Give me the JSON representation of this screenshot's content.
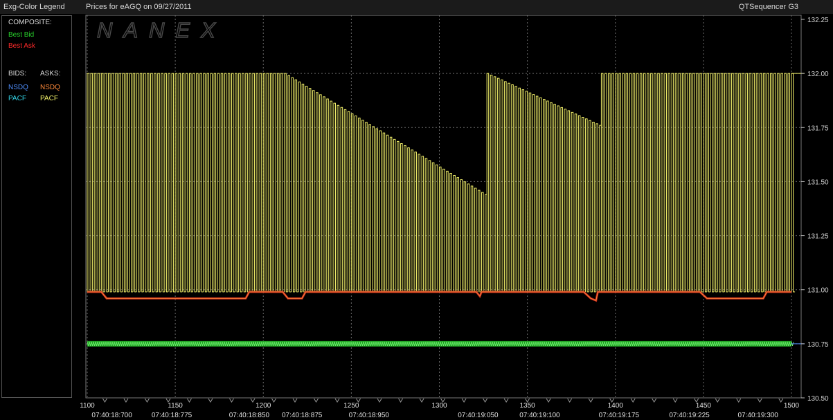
{
  "window": {
    "legend_title": "Exg-Color Legend",
    "chart_title": "Prices for  eAGQ  on  09/27/2011",
    "app_name": "QTSequencer G3"
  },
  "legend": {
    "composite_label": "COMPOSITE:",
    "best_bid": "Best Bid",
    "best_ask": "Best Ask",
    "bids_label": "BIDS:",
    "asks_label": "ASKS:",
    "bids": [
      {
        "name": "NSDQ",
        "color": "#4f8fff"
      },
      {
        "name": "PACF",
        "color": "#33d6e8"
      }
    ],
    "asks": [
      {
        "name": "NSDQ",
        "color": "#ff8a3a"
      },
      {
        "name": "PACF",
        "color": "#f2f06a"
      }
    ],
    "best_bid_color": "#28d12c",
    "best_ask_color": "#ff2a2a"
  },
  "watermark": "NANEX",
  "chart_data": {
    "type": "line",
    "title": "Prices for  eAGQ  on  09/27/2011",
    "xlabel": "",
    "ylabel": "",
    "xlim": [
      1100,
      1500
    ],
    "ylim": [
      130.5,
      132.25
    ],
    "y_ticks": [
      "132.25",
      "132.00",
      "131.75",
      "131.50",
      "131.25",
      "131.00",
      "130.75",
      "130.50"
    ],
    "x_ticks": [
      {
        "seq": 1100,
        "label": "1100"
      },
      {
        "seq": 1150,
        "label": "1150"
      },
      {
        "seq": 1200,
        "label": "1200"
      },
      {
        "seq": 1250,
        "label": "1250"
      },
      {
        "seq": 1300,
        "label": "1300"
      },
      {
        "seq": 1350,
        "label": "1350"
      },
      {
        "seq": 1400,
        "label": "1400"
      },
      {
        "seq": 1450,
        "label": "1450"
      },
      {
        "seq": 1500,
        "label": "1500"
      }
    ],
    "time_labels": [
      {
        "seq": 1114,
        "label": "07:40:18:700"
      },
      {
        "seq": 1148,
        "label": "07:40:18:775"
      },
      {
        "seq": 1192,
        "label": "07:40:18:850"
      },
      {
        "seq": 1222,
        "label": "07:40:18:875"
      },
      {
        "seq": 1260,
        "label": "07:40:18:950"
      },
      {
        "seq": 1322,
        "label": "07:40:19:050"
      },
      {
        "seq": 1357,
        "label": "07:40:19:100"
      },
      {
        "seq": 1402,
        "label": "07:40:19:175"
      },
      {
        "seq": 1442,
        "label": "07:40:19:225"
      },
      {
        "seq": 1481,
        "label": "07:40:19:300"
      }
    ],
    "gridlines": true,
    "price_levels": {
      "ask_high": 132.0,
      "ask_low": 130.99,
      "best_bid": 130.75
    },
    "series": [
      {
        "name": "PACF",
        "side": "ask",
        "color": "#f2f06a",
        "pattern": "oscillating between high and low levels; high level per segment",
        "segments": [
          {
            "from": 1100,
            "to": 1211,
            "high_start": 132.0,
            "high_end": 132.0
          },
          {
            "from": 1212,
            "to": 1326,
            "high_start": 132.0,
            "high_end": 131.44
          },
          {
            "from": 1327,
            "to": 1391,
            "high_start": 132.0,
            "high_end": 131.76
          },
          {
            "from": 1392,
            "to": 1500,
            "high_start": 132.0,
            "high_end": 132.0
          }
        ],
        "low": 130.99
      },
      {
        "name": "NSDQ",
        "side": "ask",
        "color": "#ff8a3a",
        "points": [
          [
            1100,
            130.99
          ],
          [
            1108,
            130.99
          ],
          [
            1111,
            130.96
          ],
          [
            1190,
            130.96
          ],
          [
            1192,
            130.99
          ],
          [
            1211,
            130.99
          ],
          [
            1214,
            130.96
          ],
          [
            1222,
            130.96
          ],
          [
            1224,
            130.99
          ],
          [
            1321,
            130.99
          ],
          [
            1323,
            130.97
          ],
          [
            1324,
            130.99
          ],
          [
            1382,
            130.99
          ],
          [
            1386,
            130.96
          ],
          [
            1389,
            130.95
          ],
          [
            1390,
            130.99
          ],
          [
            1448,
            130.99
          ],
          [
            1452,
            130.96
          ],
          [
            1484,
            130.96
          ],
          [
            1486,
            130.99
          ],
          [
            1500,
            130.99
          ]
        ]
      },
      {
        "name": "Best Bid",
        "side": "bid",
        "color": "#28d12c",
        "points": [
          [
            1100,
            130.75
          ],
          [
            1500,
            130.75
          ]
        ]
      }
    ]
  }
}
